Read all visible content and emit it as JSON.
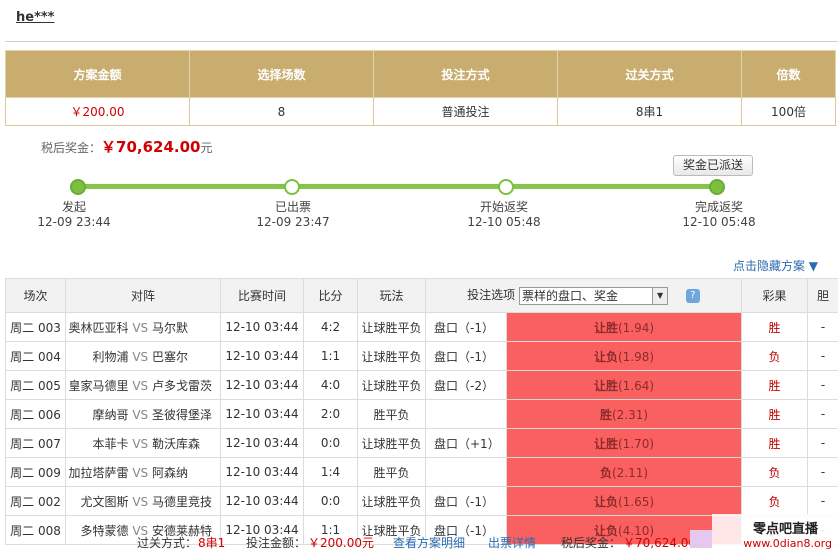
{
  "user": "he***",
  "summary": {
    "headers": [
      "方案金额",
      "选择场数",
      "投注方式",
      "过关方式",
      "倍数"
    ],
    "values": [
      "￥200.00",
      "8",
      "普通投注",
      "8串1",
      "100倍"
    ]
  },
  "prize": {
    "label": "税后奖金：",
    "amount": "￥70,624.00",
    "unit": "元"
  },
  "sent_button": "奖金已派送",
  "progress": {
    "steps": [
      {
        "label": "发起",
        "time": "12-09 23:44"
      },
      {
        "label": "已出票",
        "time": "12-09 23:47"
      },
      {
        "label": "开始返奖",
        "time": "12-10 05:48"
      },
      {
        "label": "完成返奖",
        "time": "12-10 05:48"
      }
    ]
  },
  "show_hidden_link": "点击隐藏方案 ▼",
  "grid": {
    "headers": [
      "场次",
      "对阵",
      "比赛时间",
      "比分",
      "玩法",
      "投注选项",
      "彩果",
      "胆"
    ],
    "option_select": "票样的盘口、奖金",
    "vs": "VS",
    "rows": [
      {
        "no": "周二 003",
        "home": "奥林匹亚科",
        "away": "马尔默",
        "time": "12-10 03:44",
        "score": "4:2",
        "play": "让球胜平负",
        "handicap": "盘口（-1）",
        "pick": "让胜",
        "odds": "(1.94)",
        "result": "胜",
        "dan": "-"
      },
      {
        "no": "周二 004",
        "home": "利物浦",
        "away": "巴塞尔",
        "time": "12-10 03:44",
        "score": "1:1",
        "play": "让球胜平负",
        "handicap": "盘口（-1）",
        "pick": "让负",
        "odds": "(1.98)",
        "result": "负",
        "dan": "-"
      },
      {
        "no": "周二 005",
        "home": "皇家马德里",
        "away": "卢多戈雷茨",
        "time": "12-10 03:44",
        "score": "4:0",
        "play": "让球胜平负",
        "handicap": "盘口（-2）",
        "pick": "让胜",
        "odds": "(1.64)",
        "result": "胜",
        "dan": "-"
      },
      {
        "no": "周二 006",
        "home": "摩纳哥",
        "away": "圣彼得堡泽",
        "time": "12-10 03:44",
        "score": "2:0",
        "play": "胜平负",
        "handicap": "",
        "pick": "胜",
        "odds": "(2.31)",
        "result": "胜",
        "dan": "-"
      },
      {
        "no": "周二 007",
        "home": "本菲卡",
        "away": "勒沃库森",
        "time": "12-10 03:44",
        "score": "0:0",
        "play": "让球胜平负",
        "handicap": "盘口（+1）",
        "pick": "让胜",
        "odds": "(1.70)",
        "result": "胜",
        "dan": "-"
      },
      {
        "no": "周二 009",
        "home": "加拉塔萨雷",
        "away": "阿森纳",
        "time": "12-10 03:44",
        "score": "1:4",
        "play": "胜平负",
        "handicap": "",
        "pick": "负",
        "odds": "(2.11)",
        "result": "负",
        "dan": "-"
      },
      {
        "no": "周二 002",
        "home": "尤文图斯",
        "away": "马德里竞技",
        "time": "12-10 03:44",
        "score": "0:0",
        "play": "让球胜平负",
        "handicap": "盘口（-1）",
        "pick": "让负",
        "odds": "(1.65)",
        "result": "负",
        "dan": "-"
      },
      {
        "no": "周二 008",
        "home": "多特蒙德",
        "away": "安德莱赫特",
        "time": "12-10 03:44",
        "score": "1:1",
        "play": "让球胜平负",
        "handicap": "盘口（-1）",
        "pick": "让负",
        "odds": "(4.10)",
        "result": "负",
        "dan": "-"
      }
    ]
  },
  "footer": {
    "pass_label": "过关方式：",
    "pass_value": "8串1",
    "amount_label": "投注金额：",
    "amount_value": "￥200.00元",
    "detail_link": "查看方案明细",
    "ticket_link": "出票详情",
    "prize_label": "税后奖金：",
    "prize_value": "￥70,624.00元"
  },
  "watermark": {
    "line1": "零点吧直播",
    "line2": "www.0dian8.org"
  }
}
